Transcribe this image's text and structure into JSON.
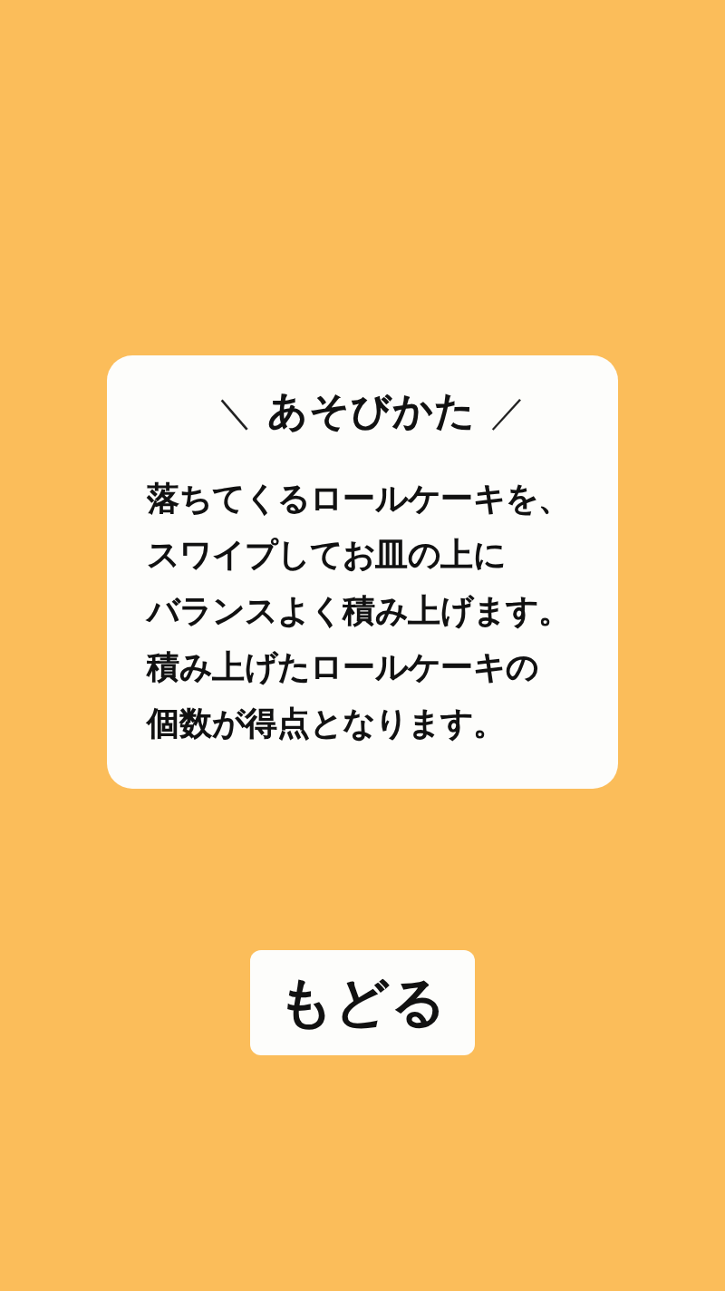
{
  "card": {
    "title_left": "＼",
    "title": "あそびかた",
    "title_right": "／",
    "lines": [
      "落ちてくるロールケーキを、",
      "スワイプしてお皿の上に",
      "バランスよく積み上げます。",
      "積み上げたロールケーキの",
      "個数が得点となります。"
    ]
  },
  "back_button": {
    "label": "もどる"
  }
}
